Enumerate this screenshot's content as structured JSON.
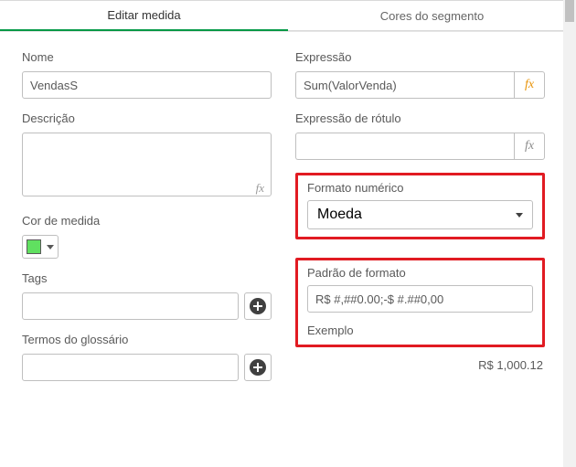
{
  "tabs": {
    "edit": "Editar medida",
    "colors": "Cores do segmento"
  },
  "left": {
    "name_label": "Nome",
    "name_value": "VendasS",
    "desc_label": "Descrição",
    "desc_value": "",
    "color_label": "Cor de medida",
    "color_swatch": "#60e060",
    "tags_label": "Tags",
    "tags_value": "",
    "glossary_label": "Termos do glossário",
    "glossary_value": ""
  },
  "right": {
    "expr_label": "Expressão",
    "expr_value": "Sum(ValorVenda)",
    "label_expr_label": "Expressão de rótulo",
    "label_expr_value": "",
    "numfmt_label": "Formato numérico",
    "numfmt_value": "Moeda",
    "pattern_label": "Padrão de formato",
    "pattern_value": "R$ #,##0.00;-$ #.##0,00",
    "example_label": "Exemplo",
    "example_value": "R$ 1,000.12"
  }
}
